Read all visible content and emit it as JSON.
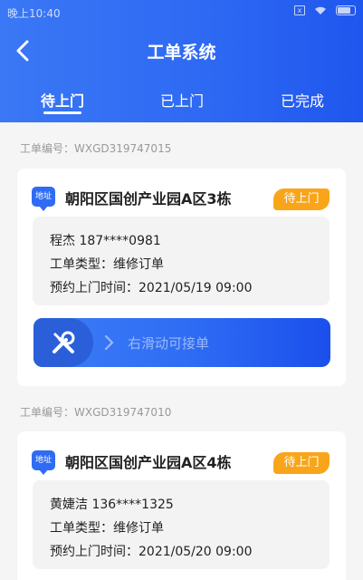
{
  "status": {
    "time": "晚上10:40",
    "sim_label": "x"
  },
  "header": {
    "title": "工单系统"
  },
  "tabs": [
    {
      "label": "待上门"
    },
    {
      "label": "已上门"
    },
    {
      "label": "已完成"
    }
  ],
  "orders": [
    {
      "order_no": "工单编号：WXGD319747015",
      "addr_icon_label": "地址",
      "address": "朝阳区国创产业园A区3栋",
      "status": "待上门",
      "contact": "程杰 187****0981",
      "type": "工单类型：维修订单",
      "appointment": "预约上门时间：2021/05/19 09:00",
      "slider_text": "右滑动可接单"
    },
    {
      "order_no": "工单编号：WXGD319747010",
      "addr_icon_label": "地址",
      "address": "朝阳区国创产业园A区4栋",
      "status": "待上门",
      "contact": "黄婕洁 136****1325",
      "type": "工单类型：维修订单",
      "appointment": "预约上门时间：2021/05/20 09:00"
    }
  ],
  "colors": {
    "primary": "#2f6cf3",
    "badge": "#f9a51a",
    "background": "#f5f5f5"
  },
  "icons": [
    "back-arrow-icon",
    "wifi-icon",
    "battery-icon",
    "tools-icon",
    "chevron-right-icon"
  ]
}
